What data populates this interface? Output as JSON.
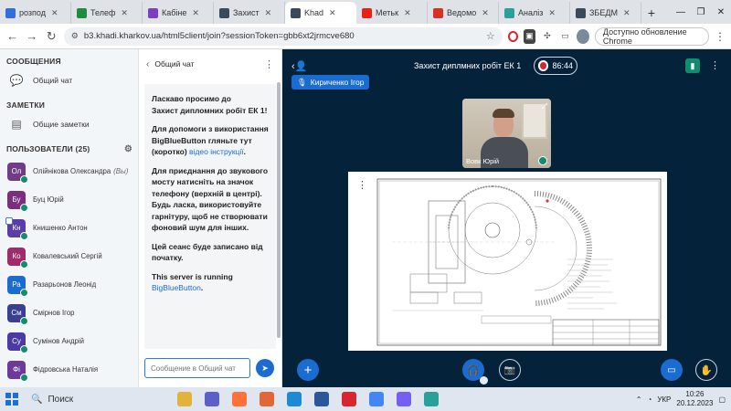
{
  "browser": {
    "tabs": [
      {
        "title": "розпод",
        "icon": "docs-icon",
        "color": "#2f6de1",
        "active": false
      },
      {
        "title": "Телеф",
        "icon": "sheets-icon",
        "color": "#1e8e3e",
        "active": false
      },
      {
        "title": "Кабіне",
        "icon": "moodle-icon",
        "color": "#7b3fbf",
        "active": false
      },
      {
        "title": "Захист",
        "icon": "bbb-icon",
        "color": "#3a4a5a",
        "active": false
      },
      {
        "title": "Khad",
        "icon": "bbb-icon",
        "color": "#3a4a5a",
        "active": true
      },
      {
        "title": "Метьк",
        "icon": "youtube-icon",
        "color": "#e62117",
        "active": false
      },
      {
        "title": "Ведомо",
        "icon": "gmail-icon",
        "color": "#d93025",
        "active": false
      },
      {
        "title": "Аналіз",
        "icon": "site-icon",
        "color": "#2aa198",
        "active": false
      },
      {
        "title": "ЗБЕДМ",
        "icon": "bbb-icon",
        "color": "#3a4a5a",
        "active": false
      }
    ],
    "url": "b3.khadi.kharkov.ua/html5client/join?sessionToken=gbb6xt2jrmcve680",
    "update_label": "Доступно обновление Chrome"
  },
  "sidebar": {
    "messages_heading": "СООБЩЕНИЯ",
    "public_chat_label": "Общий чат",
    "notes_heading": "ЗАМЕТКИ",
    "shared_notes_label": "Общие заметки",
    "users_heading": "ПОЛЬЗОВАТЕЛИ (25)",
    "users": [
      {
        "initials": "Ол",
        "name": "Олійнікова Олександра",
        "suffix": "(Вы)",
        "color": "#6f3c85",
        "presenter": false
      },
      {
        "initials": "Бу",
        "name": "Буц Юрій",
        "suffix": "",
        "color": "#7b2d7e",
        "presenter": false
      },
      {
        "initials": "Кн",
        "name": "Книшенко Антон",
        "suffix": "",
        "color": "#5a3ea6",
        "presenter": true
      },
      {
        "initials": "Ко",
        "name": "Ковалевський Сергій",
        "suffix": "",
        "color": "#a02b6b",
        "presenter": false
      },
      {
        "initials": "Ра",
        "name": "Разарьонов Леонід",
        "suffix": "",
        "color": "#1b6cd0",
        "presenter": false
      },
      {
        "initials": "См",
        "name": "Смірнов Ігор",
        "suffix": "",
        "color": "#3b3f8f",
        "presenter": false
      },
      {
        "initials": "Су",
        "name": "Сумінов Андрій",
        "suffix": "",
        "color": "#4b3aa6",
        "presenter": false
      },
      {
        "initials": "Фі",
        "name": "Фідровська Наталія",
        "suffix": "",
        "color": "#6b3a9a",
        "presenter": false
      }
    ]
  },
  "chat": {
    "title": "Общий чат",
    "welcome_1": "Ласкаво просимо до",
    "welcome_2": "Захист дипломних робіт ЕК 1",
    "welcome_3": "!",
    "help_text": "Для допомоги з використання BigBlueButton гляньте тут (коротко)",
    "help_link": "відео інструкції",
    "help_end": ".",
    "audio_text": "Для приєднання до звукового мосту натисніть на значок телефону (верхній в центрі).",
    "audio_bold": "Будь ласка, використовуйте гарнітуру, щоб не створювати фоновий шум для інших.",
    "recording_text": "Цей сеанс буде записано від початку.",
    "server_text": "This server is running",
    "server_link": "BigBlueButton",
    "server_end": ".",
    "input_placeholder": "Сообщение в Общий чат"
  },
  "main": {
    "session_title": "Захист диплмних робіт ЕК 1",
    "record_time": "86:44",
    "talking_user": "Кириченко Ігор",
    "webcam_name": "Вовк Юрій"
  },
  "taskbar": {
    "search_label": "Поиск",
    "language": "УКР",
    "time": "10:26",
    "date": "20.12.2023",
    "apps": [
      {
        "icon": "explorer-icon",
        "color": "#e2b33b"
      },
      {
        "icon": "teams-icon",
        "color": "#5b5fc7"
      },
      {
        "icon": "firefox-icon",
        "color": "#ff7139"
      },
      {
        "icon": "matlab-icon",
        "color": "#e16737"
      },
      {
        "icon": "edge-icon",
        "color": "#1f8ad4"
      },
      {
        "icon": "word-icon",
        "color": "#2b579a"
      },
      {
        "icon": "opera-icon",
        "color": "#d8262e"
      },
      {
        "icon": "chrome-icon",
        "color": "#4285f4"
      },
      {
        "icon": "viber-icon",
        "color": "#7360f2"
      },
      {
        "icon": "app-icon",
        "color": "#2aa198"
      }
    ]
  }
}
